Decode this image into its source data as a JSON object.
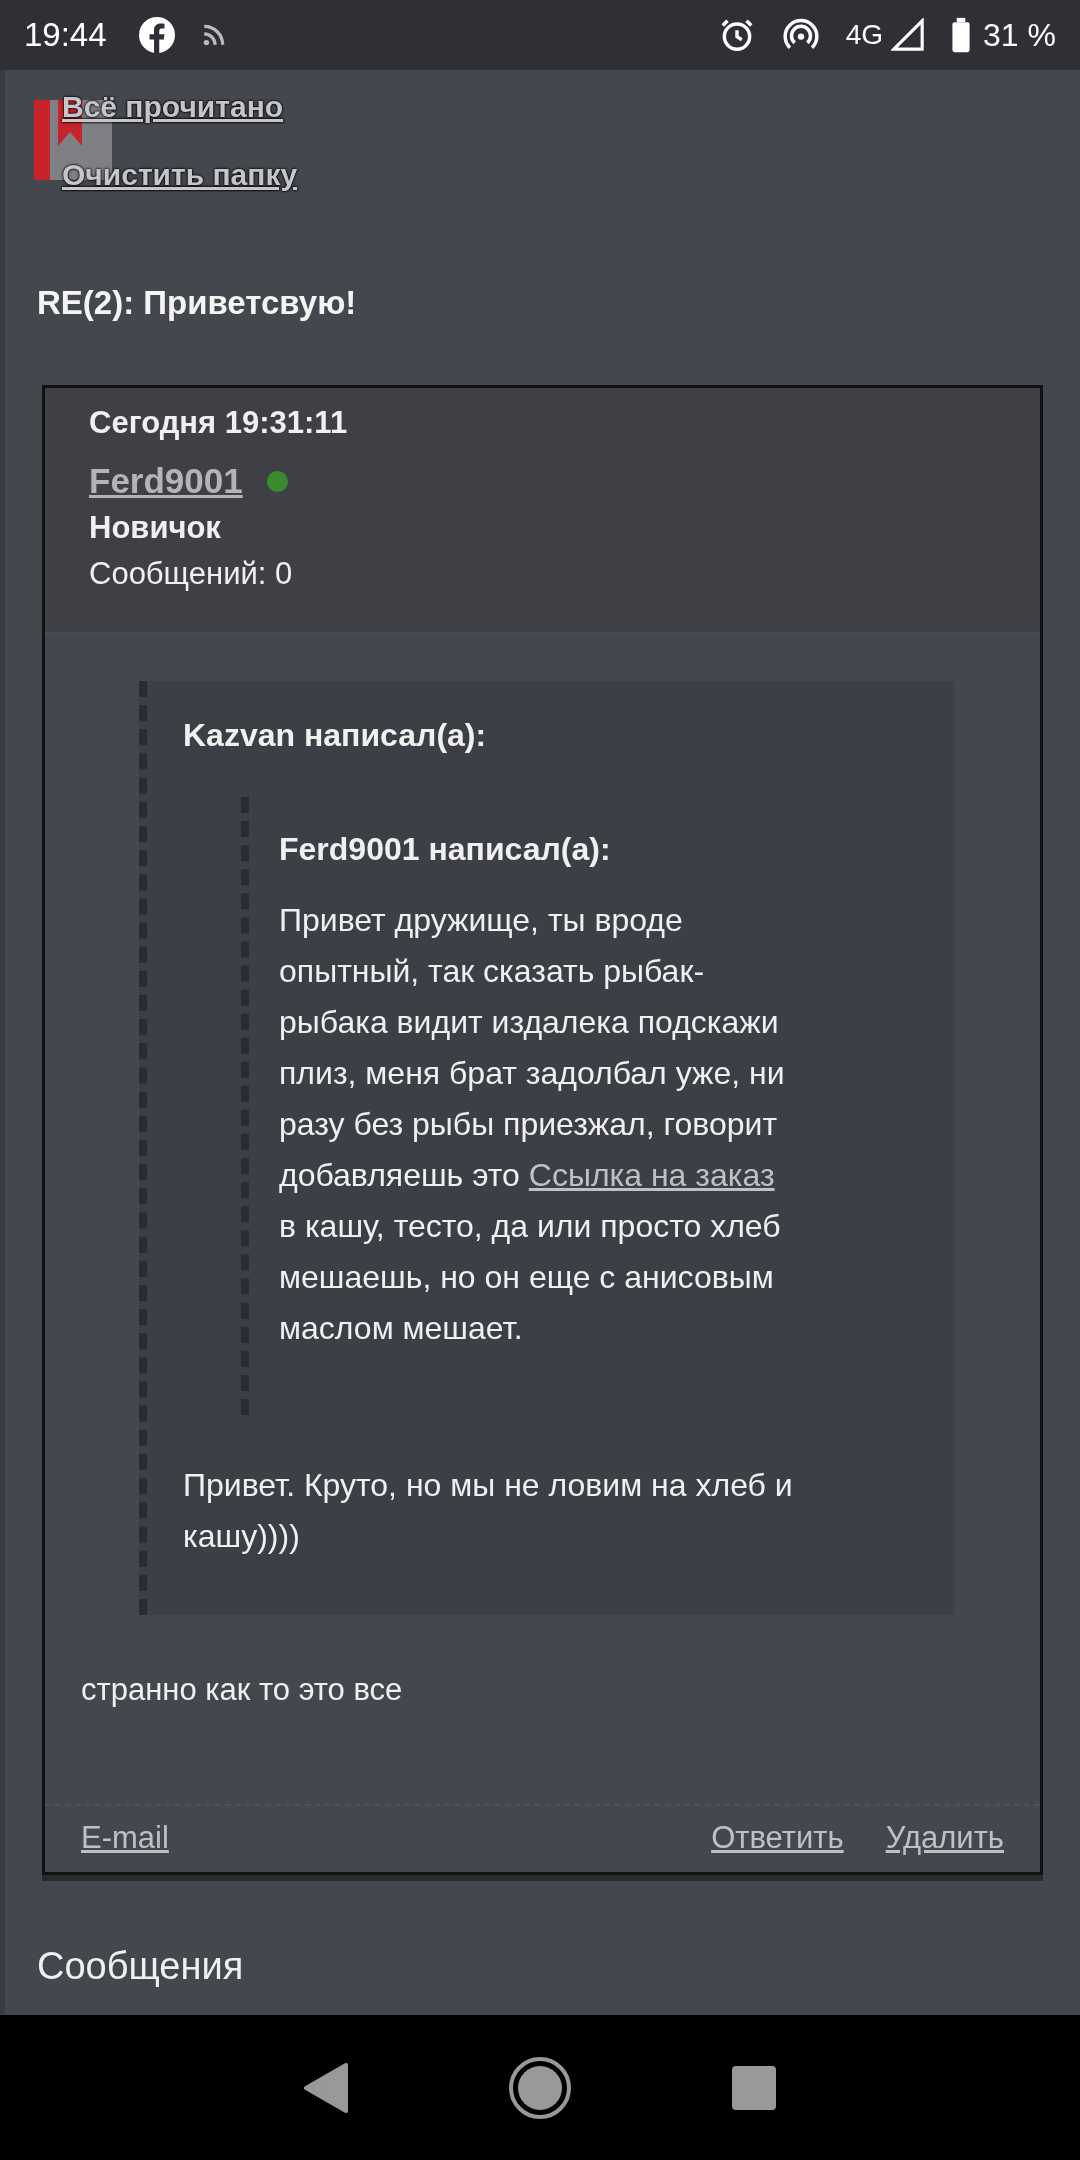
{
  "status_bar": {
    "time": "19:44",
    "network": "4G",
    "battery": "31 %"
  },
  "folder_links": [
    "Всё прочитано",
    "Очистить папку"
  ],
  "message_title": "RE(2): Приветсвую!",
  "post": {
    "date": "Сегодня 19:31:11",
    "author": "Ferd9001",
    "online": true,
    "rank": "Новичок",
    "posts": "Сообщений: 0",
    "quote": {
      "header": "Kazvan написал(а):",
      "inner_quote": {
        "header": "Ferd9001 написал(а):",
        "text_before": "Привет дружище, ты вроде опытный, так сказать рыбак-рыбака видит издалека подскажи плиз, меня брат задолбал уже, ни разу без рыбы приезжал, говорит добавляешь это",
        "link": "Ссылка на заказ",
        "text_after": "в кашу, тесто, да или просто хлеб мешаешь, но он еще с анисовым маслом мешает."
      },
      "text": "Привет. Круто, но мы не ловим на хлеб и кашу))))"
    },
    "body": "странно как то это все",
    "actions_left": [
      "E-mail"
    ],
    "actions_right": [
      "Ответить",
      "Удалить"
    ]
  },
  "section_title": "Сообщения"
}
